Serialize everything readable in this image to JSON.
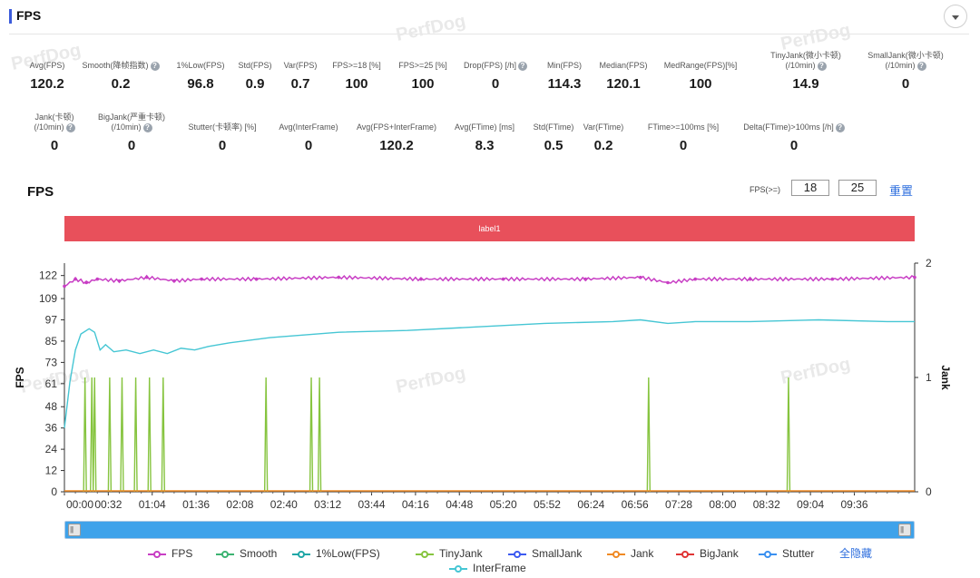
{
  "section": {
    "title": "FPS"
  },
  "watermark": "PerfDog",
  "stats_row1": [
    {
      "label": "Avg(FPS)",
      "value": "120.2",
      "help": false
    },
    {
      "label": "Smooth(降帧指数)",
      "value": "0.2",
      "help": true
    },
    {
      "label": "1%Low(FPS)",
      "value": "96.8",
      "help": false
    },
    {
      "label": "Std(FPS)",
      "value": "0.9",
      "help": false
    },
    {
      "label": "Var(FPS)",
      "value": "0.7",
      "help": false
    },
    {
      "label": "FPS>=18 [%]",
      "value": "100",
      "help": false
    },
    {
      "label": "FPS>=25 [%]",
      "value": "100",
      "help": false
    },
    {
      "label": "Drop(FPS) [/h]",
      "value": "0",
      "help": true
    },
    {
      "label": "Min(FPS)",
      "value": "114.3",
      "help": false
    },
    {
      "label": "Median(FPS)",
      "value": "120.1",
      "help": false
    },
    {
      "label": "MedRange(FPS)[%]",
      "value": "100",
      "help": false
    },
    {
      "label": "TinyJank(微小卡顿)\n(/10min)",
      "value": "14.9",
      "help": true
    },
    {
      "label": "SmallJank(微小卡顿)\n(/10min)",
      "value": "0",
      "help": true
    }
  ],
  "stats_row2": [
    {
      "label": "Jank(卡顿)\n(/10min)",
      "value": "0",
      "help": true
    },
    {
      "label": "BigJank(严重卡顿)\n(/10min)",
      "value": "0",
      "help": true
    },
    {
      "label": "Stutter(卡顿率) [%]",
      "value": "0",
      "help": false
    },
    {
      "label": "Avg(InterFrame)",
      "value": "0",
      "help": false
    },
    {
      "label": "Avg(FPS+InterFrame)",
      "value": "120.2",
      "help": false
    },
    {
      "label": "Avg(FTime) [ms]",
      "value": "8.3",
      "help": false
    },
    {
      "label": "Std(FTime)",
      "value": "0.5",
      "help": false
    },
    {
      "label": "Var(FTime)",
      "value": "0.2",
      "help": false
    },
    {
      "label": "FTime>=100ms [%]",
      "value": "0",
      "help": false
    },
    {
      "label": "Delta(FTime)>100ms [/h]",
      "value": "0",
      "help": true
    }
  ],
  "chart_title": "FPS",
  "fps_threshold": {
    "label": "FPS(>=)",
    "value1": "18",
    "value2": "25",
    "reset_label": "重置"
  },
  "label_band": "label1",
  "legend": {
    "items": [
      "FPS",
      "Smooth",
      "1%Low(FPS)",
      "TinyJank",
      "SmallJank",
      "Jank",
      "BigJank",
      "Stutter",
      "InterFrame"
    ],
    "hide_all": "全隐藏"
  },
  "colors": {
    "FPS": "#c83ec4",
    "Smooth": "#3cb371",
    "1%Low(FPS)": "#20a7a7",
    "TinyJank": "#86c43f",
    "SmallJank": "#3d5af1",
    "Jank": "#f08a24",
    "BigJank": "#e03535",
    "Stutter": "#3a90f0",
    "InterFrame": "#46c6d4",
    "accent": "#2f6fde",
    "label_band": "#e8505b"
  },
  "chart_data": {
    "type": "line",
    "ylabel": "FPS",
    "y2label": "Jank",
    "y_ticks": [
      0,
      12,
      24,
      36,
      48,
      61,
      73,
      85,
      97,
      109,
      122
    ],
    "y2_ticks": [
      0,
      1,
      2
    ],
    "ylim": [
      0,
      129
    ],
    "y2lim": [
      0,
      2
    ],
    "x_tick_labels": [
      "00:00",
      "00:32",
      "01:04",
      "01:36",
      "02:08",
      "02:40",
      "03:12",
      "03:44",
      "04:16",
      "04:48",
      "05:20",
      "05:52",
      "06:24",
      "06:56",
      "07:28",
      "08:00",
      "08:32",
      "09:04",
      "09:36"
    ],
    "xlim_seconds": [
      0,
      620
    ],
    "series": [
      {
        "name": "FPS",
        "x": [
          0,
          8,
          16,
          24,
          40,
          60,
          80,
          100,
          140,
          200,
          260,
          320,
          380,
          420,
          440,
          460,
          500,
          560,
          620
        ],
        "values": [
          116,
          120,
          118,
          120,
          119,
          121,
          119,
          120,
          120,
          121,
          120,
          120,
          120,
          121,
          118,
          120,
          120,
          120,
          121
        ]
      },
      {
        "name": "InterFrame",
        "x": [
          0,
          4,
          8,
          12,
          18,
          22,
          26,
          30,
          36,
          45,
          55,
          65,
          75,
          85,
          95,
          105,
          120,
          150,
          200,
          250,
          300,
          350,
          400,
          420,
          440,
          460,
          500,
          550,
          600,
          620
        ],
        "values": [
          36,
          62,
          80,
          89,
          92,
          90,
          80,
          83,
          79,
          80,
          78,
          80,
          78,
          81,
          80,
          82,
          84,
          87,
          90,
          91,
          93,
          95,
          96,
          97,
          95,
          96,
          96,
          97,
          96,
          96
        ]
      },
      {
        "name": "TinyJank",
        "x": [
          15,
          20,
          22,
          33,
          42,
          52,
          62,
          72,
          147,
          180,
          186,
          426,
          528
        ],
        "values": [
          1,
          1,
          1,
          1,
          1,
          1,
          1,
          1,
          1,
          1,
          1,
          1,
          1
        ]
      }
    ]
  }
}
